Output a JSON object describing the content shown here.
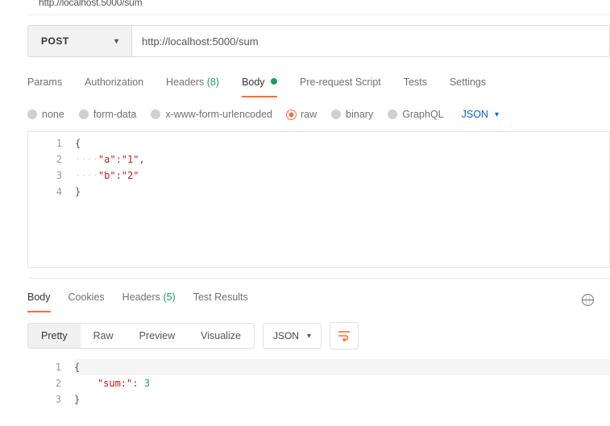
{
  "cruft_line": "http.//localhost.5000/sum",
  "method": "POST",
  "url": "http://localhost:5000/sum",
  "tabs": {
    "params": "Params",
    "authorization": "Authorization",
    "headers_label": "Headers",
    "headers_count": "(8)",
    "body": "Body",
    "prerequest": "Pre-request Script",
    "tests": "Tests",
    "settings": "Settings"
  },
  "body_types": {
    "none": "none",
    "formdata": "form-data",
    "urlencoded": "x-www-form-urlencoded",
    "raw": "raw",
    "binary": "binary",
    "graphql": "GraphQL",
    "format_label": "JSON"
  },
  "request_body_lines": {
    "1": "{",
    "2a_key": "\"a\"",
    "2a_val": "\"1\"",
    "3b_key": "\"b\"",
    "3b_val": "\"2\"",
    "4": "}"
  },
  "response_tabs": {
    "body": "Body",
    "cookies": "Cookies",
    "headers_label": "Headers",
    "headers_count": "(5)",
    "test_results": "Test Results"
  },
  "response_toolbar": {
    "pretty": "Pretty",
    "raw": "Raw",
    "preview": "Preview",
    "visualize": "Visualize",
    "format_label": "JSON"
  },
  "response_body_lines": {
    "1": "{",
    "2_key": "\"sum:\"",
    "2_val": "3",
    "3": "}"
  }
}
